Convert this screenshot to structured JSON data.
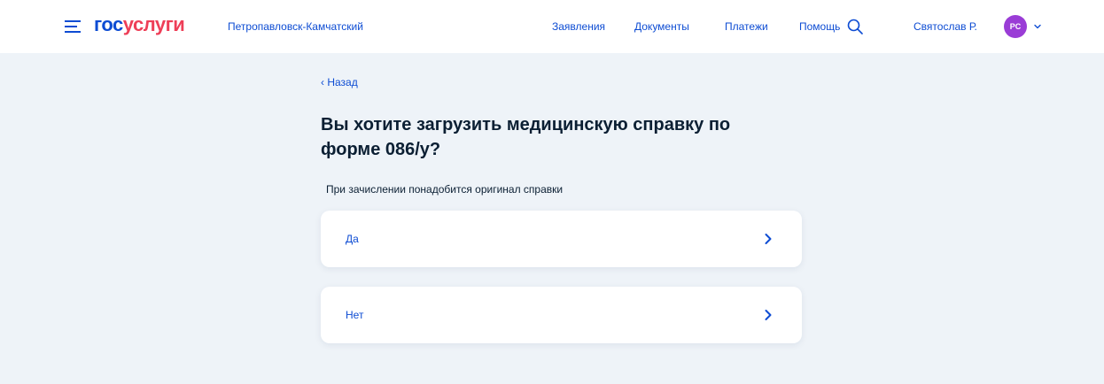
{
  "header": {
    "logo_part1": "гос",
    "logo_part2": "услуги",
    "region": "Петропавловск-Камчатский",
    "nav": [
      "Заявления",
      "Документы",
      "Платежи",
      "Помощь"
    ],
    "user_name": "Святослав Р.",
    "avatar_initials": "PC"
  },
  "page": {
    "back_label": "‹ Назад",
    "title": "Вы хотите загрузить медицинскую справку по форме 086/у?",
    "subtitle": "При зачислении понадобится оригинал справки",
    "options": [
      {
        "label": "Да"
      },
      {
        "label": "Нет"
      }
    ]
  },
  "colors": {
    "accent": "#0d4cd3",
    "logo_red": "#ee3f58",
    "avatar_bg": "#9a3cd6",
    "page_bg": "#eef3f8",
    "title_text": "#0b1f33"
  },
  "icons": {
    "menu": "menu-icon",
    "search": "search-icon",
    "user_menu": "chevron-down-icon",
    "option": "chevron-right-icon"
  }
}
